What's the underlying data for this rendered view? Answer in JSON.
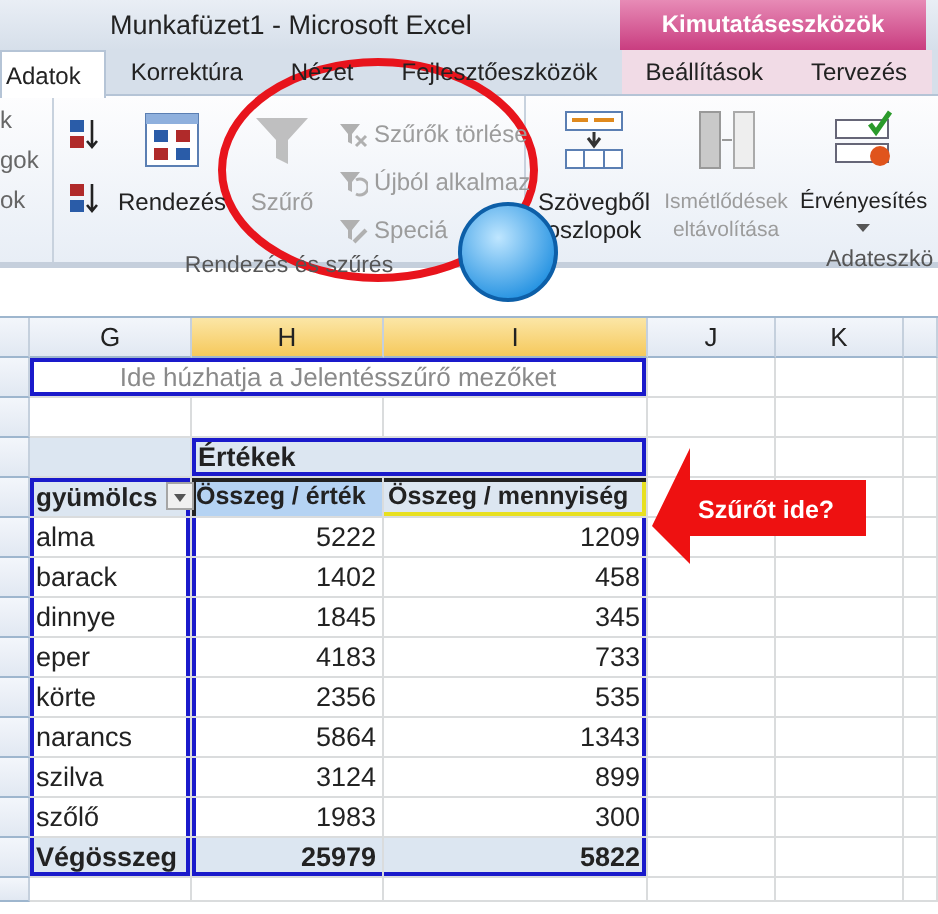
{
  "window": {
    "title": "Munkafüzet1  -  Microsoft Excel"
  },
  "contextual_tab_group": "Kimutatáseszközök",
  "tabs": [
    {
      "label": "Adatok",
      "selected": true,
      "contextual": false
    },
    {
      "label": "Korrektúra",
      "selected": false,
      "contextual": false
    },
    {
      "label": "Nézet",
      "selected": false,
      "contextual": false
    },
    {
      "label": "Fejlesztőeszközök",
      "selected": false,
      "contextual": false
    },
    {
      "label": "Beállítások",
      "selected": false,
      "contextual": true
    },
    {
      "label": "Tervezés",
      "selected": false,
      "contextual": true
    }
  ],
  "ribbon": {
    "cut_labels": [
      "k",
      "gok",
      "ok"
    ],
    "groups": [
      {
        "label": "Rendezés és szűrés",
        "items": [
          {
            "kind": "sortaz"
          },
          {
            "kind": "sortza"
          },
          {
            "kind": "sort",
            "label": "Rendezés",
            "disabled": false
          },
          {
            "kind": "filter",
            "label": "Szűrő",
            "disabled": true
          },
          {
            "kind": "clear",
            "label": "Szűrők törlése",
            "disabled": true
          },
          {
            "kind": "reapply",
            "label": "Újból alkalmaz",
            "disabled": true
          },
          {
            "kind": "advanced",
            "label": "Speciá",
            "disabled": true
          }
        ]
      },
      {
        "label": "Adateszkö",
        "items": [
          {
            "kind": "split",
            "label": "Szövegből oszlopok",
            "disabled": false
          },
          {
            "kind": "dedupe",
            "label": "Ismétlődések eltávolítása",
            "disabled": true
          },
          {
            "kind": "validate",
            "label": "Érvényesítés",
            "disabled": false
          }
        ]
      }
    ]
  },
  "columns": [
    {
      "label": "G",
      "selected": false
    },
    {
      "label": "H",
      "selected": true
    },
    {
      "label": "I",
      "selected": true
    },
    {
      "label": "J",
      "selected": false
    },
    {
      "label": "K",
      "selected": false
    }
  ],
  "pivot": {
    "filter_hint": "Ide húzhatja a Jelentésszűrő mezőket",
    "values_header": "Értékek",
    "row_field": "gyümölcs",
    "value_fields": [
      "Összeg / érték",
      "Összeg / mennyiség"
    ],
    "rows": [
      {
        "label": "alma",
        "values": [
          "5222",
          "1209"
        ]
      },
      {
        "label": "barack",
        "values": [
          "1402",
          "458"
        ]
      },
      {
        "label": "dinnye",
        "values": [
          "1845",
          "345"
        ]
      },
      {
        "label": "eper",
        "values": [
          "4183",
          "733"
        ]
      },
      {
        "label": "körte",
        "values": [
          "2356",
          "535"
        ]
      },
      {
        "label": "narancs",
        "values": [
          "5864",
          "1343"
        ]
      },
      {
        "label": "szilva",
        "values": [
          "3124",
          "899"
        ]
      },
      {
        "label": "szőlő",
        "values": [
          "1983",
          "300"
        ]
      }
    ],
    "total": {
      "label": "Végösszeg",
      "values": [
        "25979",
        "5822"
      ]
    }
  },
  "callout": "Szűrőt ide?"
}
